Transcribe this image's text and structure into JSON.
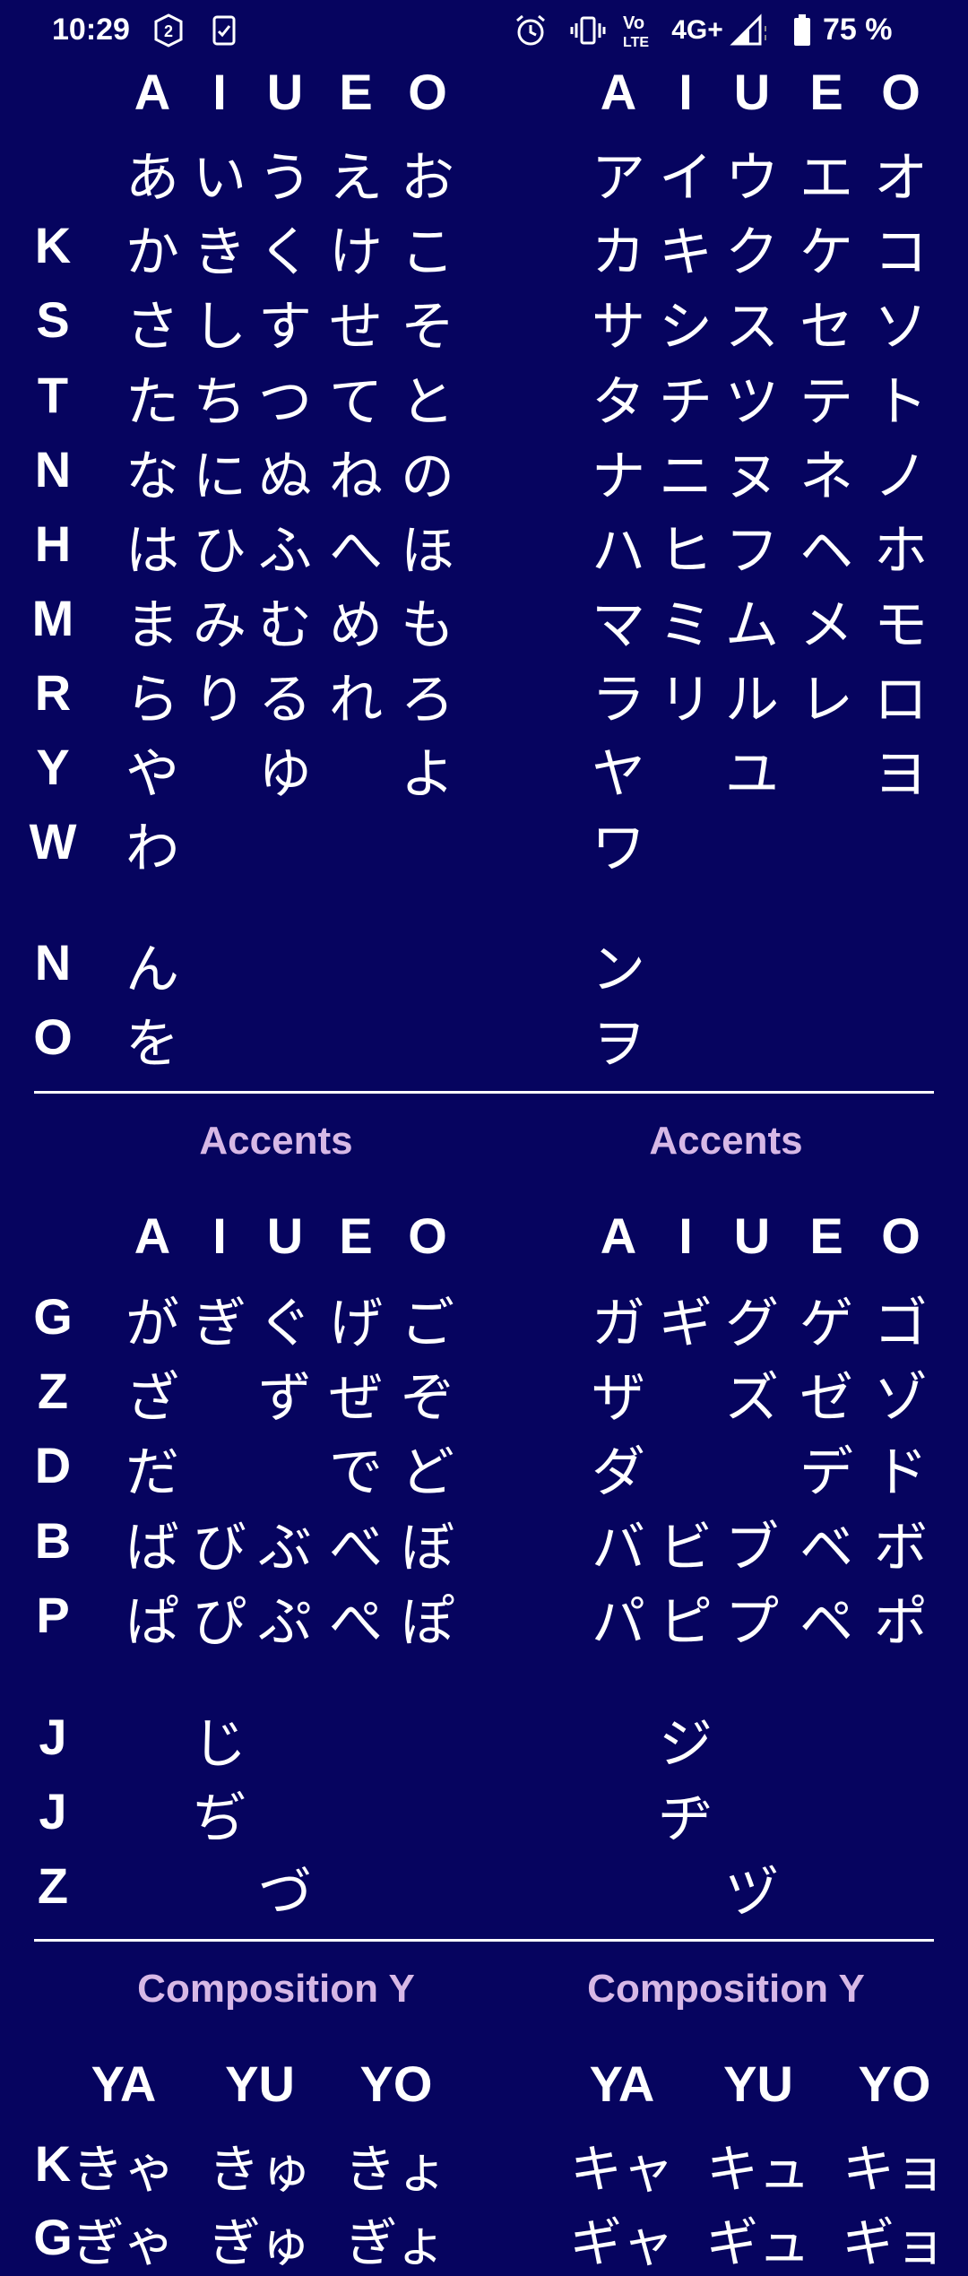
{
  "status_bar": {
    "time": "10:29",
    "notification_count": "2",
    "signal_text": "4G+",
    "volte_text": "VoLTE",
    "battery": "75 %",
    "icons": [
      "sim-badge-icon",
      "clipboard-check-icon",
      "alarm-icon",
      "vibrate-icon",
      "volte-icon",
      "signal-icon",
      "battery-icon"
    ]
  },
  "columns": [
    "A",
    "I",
    "U",
    "E",
    "O"
  ],
  "basic": {
    "rows": [
      {
        "label": "",
        "hiragana": [
          "あ",
          "い",
          "う",
          "え",
          "お"
        ],
        "katakana": [
          "ア",
          "イ",
          "ウ",
          "エ",
          "オ"
        ]
      },
      {
        "label": "K",
        "hiragana": [
          "か",
          "き",
          "く",
          "け",
          "こ"
        ],
        "katakana": [
          "カ",
          "キ",
          "ク",
          "ケ",
          "コ"
        ]
      },
      {
        "label": "S",
        "hiragana": [
          "さ",
          "し",
          "す",
          "せ",
          "そ"
        ],
        "katakana": [
          "サ",
          "シ",
          "ス",
          "セ",
          "ソ"
        ]
      },
      {
        "label": "T",
        "hiragana": [
          "た",
          "ち",
          "つ",
          "て",
          "と"
        ],
        "katakana": [
          "タ",
          "チ",
          "ツ",
          "テ",
          "ト"
        ]
      },
      {
        "label": "N",
        "hiragana": [
          "な",
          "に",
          "ぬ",
          "ね",
          "の"
        ],
        "katakana": [
          "ナ",
          "ニ",
          "ヌ",
          "ネ",
          "ノ"
        ]
      },
      {
        "label": "H",
        "hiragana": [
          "は",
          "ひ",
          "ふ",
          "へ",
          "ほ"
        ],
        "katakana": [
          "ハ",
          "ヒ",
          "フ",
          "ヘ",
          "ホ"
        ]
      },
      {
        "label": "M",
        "hiragana": [
          "ま",
          "み",
          "む",
          "め",
          "も"
        ],
        "katakana": [
          "マ",
          "ミ",
          "ム",
          "メ",
          "モ"
        ]
      },
      {
        "label": "R",
        "hiragana": [
          "ら",
          "り",
          "る",
          "れ",
          "ろ"
        ],
        "katakana": [
          "ラ",
          "リ",
          "ル",
          "レ",
          "ロ"
        ]
      },
      {
        "label": "Y",
        "hiragana": [
          "や",
          "",
          "ゆ",
          "",
          "よ"
        ],
        "katakana": [
          "ヤ",
          "",
          "ユ",
          "",
          "ヨ"
        ]
      },
      {
        "label": "W",
        "hiragana": [
          "わ",
          "",
          "",
          "",
          ""
        ],
        "katakana": [
          "ワ",
          "",
          "",
          "",
          ""
        ]
      }
    ],
    "extra": [
      {
        "label": "N",
        "hiragana": "ん",
        "katakana": "ン"
      },
      {
        "label": "O",
        "hiragana": "を",
        "katakana": "ヲ"
      }
    ]
  },
  "accents": {
    "title_left": "Accents",
    "title_right": "Accents",
    "rows": [
      {
        "label": "G",
        "hiragana": [
          "が",
          "ぎ",
          "ぐ",
          "げ",
          "ご"
        ],
        "katakana": [
          "ガ",
          "ギ",
          "グ",
          "ゲ",
          "ゴ"
        ]
      },
      {
        "label": "Z",
        "hiragana": [
          "ざ",
          "",
          "ず",
          "ぜ",
          "ぞ"
        ],
        "katakana": [
          "ザ",
          "",
          "ズ",
          "ゼ",
          "ゾ"
        ]
      },
      {
        "label": "D",
        "hiragana": [
          "だ",
          "",
          "",
          "で",
          "ど"
        ],
        "katakana": [
          "ダ",
          "",
          "",
          "デ",
          "ド"
        ]
      },
      {
        "label": "B",
        "hiragana": [
          "ば",
          "び",
          "ぶ",
          "べ",
          "ぼ"
        ],
        "katakana": [
          "バ",
          "ビ",
          "ブ",
          "ベ",
          "ボ"
        ]
      },
      {
        "label": "P",
        "hiragana": [
          "ぱ",
          "ぴ",
          "ぷ",
          "ぺ",
          "ぽ"
        ],
        "katakana": [
          "パ",
          "ピ",
          "プ",
          "ペ",
          "ポ"
        ]
      }
    ],
    "extra": [
      {
        "label": "J",
        "col": 1,
        "hiragana": "じ",
        "katakana": "ジ"
      },
      {
        "label": "J",
        "col": 1,
        "hiragana": "ぢ",
        "katakana": "ヂ"
      },
      {
        "label": "Z",
        "col": 2,
        "hiragana": "づ",
        "katakana": "ヅ"
      }
    ]
  },
  "composition": {
    "title_left": "Composition Y",
    "title_right": "Composition Y",
    "columns": [
      "YA",
      "YU",
      "YO"
    ],
    "rows": [
      {
        "label": "K",
        "hiragana": [
          "きゃ",
          "きゅ",
          "きょ"
        ],
        "katakana": [
          "キャ",
          "キュ",
          "キョ"
        ]
      },
      {
        "label": "G",
        "hiragana": [
          "ぎゃ",
          "ぎゅ",
          "ぎょ"
        ],
        "katakana": [
          "ギャ",
          "ギュ",
          "ギョ"
        ]
      }
    ]
  }
}
